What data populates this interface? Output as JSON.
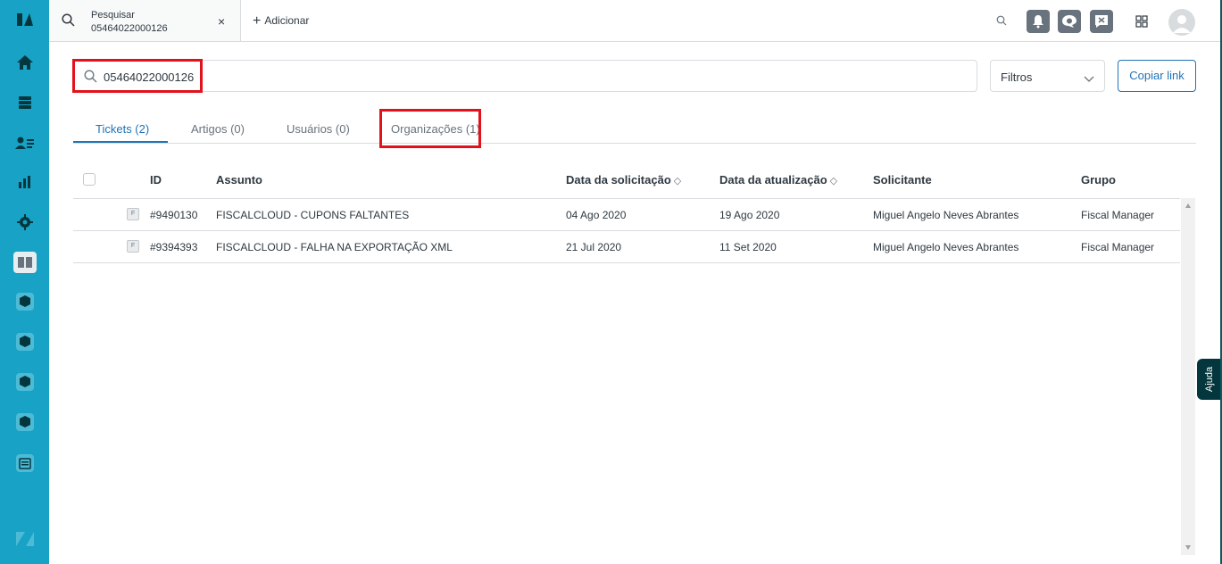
{
  "workspace_tab": {
    "title": "Pesquisar",
    "subtitle": "05464022000126",
    "close": "×"
  },
  "add_tab_label": "Adicionar",
  "search": {
    "value": "05464022000126",
    "filter_label": "Filtros",
    "copy_link_label": "Copiar link"
  },
  "result_tabs": [
    {
      "label": "Tickets (2)",
      "active": true
    },
    {
      "label": "Artigos (0)",
      "active": false
    },
    {
      "label": "Usuários (0)",
      "active": false
    },
    {
      "label": "Organizações (1)",
      "active": false
    }
  ],
  "table": {
    "headers": {
      "id": "ID",
      "subject": "Assunto",
      "requested": "Data da solicitação",
      "updated": "Data da atualização",
      "requester": "Solicitante",
      "group": "Grupo"
    },
    "rows": [
      {
        "badge": "F",
        "id": "#9490130",
        "subject": "FISCALCLOUD - CUPONS FALTANTES",
        "requested": "04 Ago 2020",
        "updated": "19 Ago 2020",
        "requester": "Miguel Angelo Neves Abrantes",
        "group": "Fiscal Manager"
      },
      {
        "badge": "F",
        "id": "#9394393",
        "subject": "FISCALCLOUD - FALHA NA EXPORTAÇÃO XML",
        "requested": "21 Jul 2020",
        "updated": "11 Set 2020",
        "requester": "Miguel Angelo Neves Abrantes",
        "group": "Fiscal Manager"
      }
    ]
  },
  "help_label": "Ajuda",
  "colors": {
    "sidebar": "#17a2c6",
    "accent": "#1f73b7",
    "highlight": "#e3111b",
    "help": "#03363d"
  }
}
